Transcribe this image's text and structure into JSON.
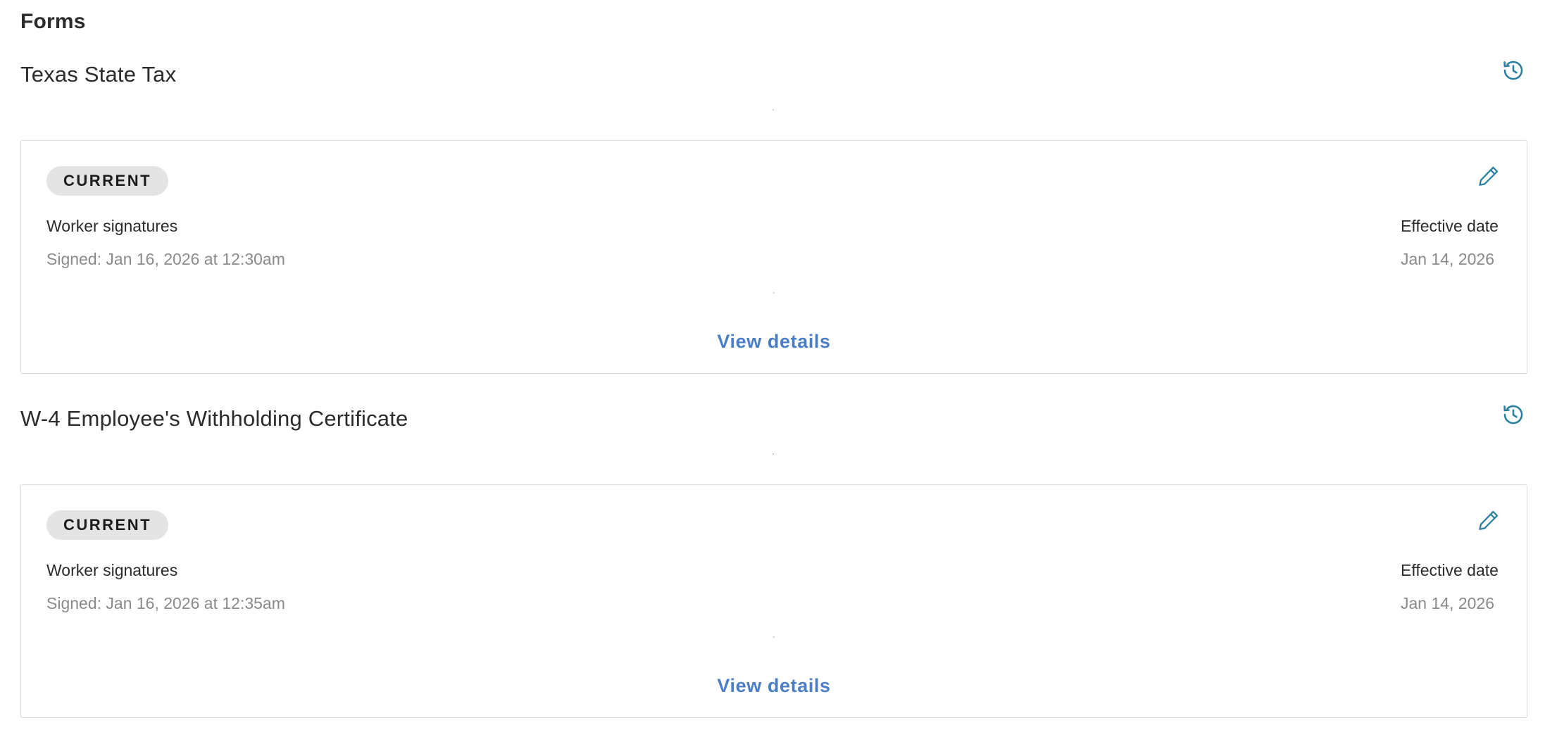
{
  "page": {
    "title": "Forms"
  },
  "icons": {
    "history": "history-icon",
    "edit": "pencil-icon"
  },
  "colors": {
    "accent": "#2a7f9e",
    "link": "#4a7fc8",
    "badge_bg": "#e4e4e4",
    "muted_text": "#8a8a8a"
  },
  "forms": [
    {
      "title": "Texas State Tax",
      "badge": "CURRENT",
      "signatures_label": "Worker signatures",
      "signed": "Signed: Jan 16, 2026 at 12:30am",
      "effective_label": "Effective date",
      "effective_date": "Jan 14, 2026",
      "link": "View details"
    },
    {
      "title": "W-4 Employee's Withholding Certificate",
      "badge": "CURRENT",
      "signatures_label": "Worker signatures",
      "signed": "Signed: Jan 16, 2026 at 12:35am",
      "effective_label": "Effective date",
      "effective_date": "Jan 14, 2026",
      "link": "View details"
    }
  ]
}
